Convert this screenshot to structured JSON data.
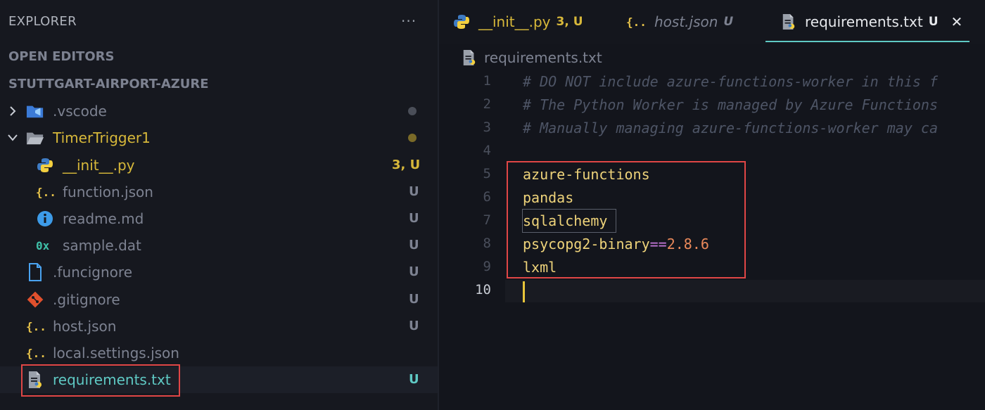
{
  "sidebar": {
    "title": "EXPLORER",
    "more": "···",
    "open_editors": "OPEN EDITORS",
    "project": "STUTTGART-AIRPORT-AZURE",
    "items": [
      {
        "name": ".vscode",
        "status": ""
      },
      {
        "name": "TimerTrigger1",
        "status": ""
      },
      {
        "name": "__init__.py",
        "status": "3, U"
      },
      {
        "name": "function.json",
        "status": "U"
      },
      {
        "name": "readme.md",
        "status": "U"
      },
      {
        "name": "sample.dat",
        "status": "U"
      },
      {
        "name": ".funcignore",
        "status": "U"
      },
      {
        "name": ".gitignore",
        "status": "U"
      },
      {
        "name": "host.json",
        "status": "U"
      },
      {
        "name": "local.settings.json",
        "status": ""
      },
      {
        "name": "requirements.txt",
        "status": "U"
      }
    ]
  },
  "tabs": [
    {
      "label": "__init__.py",
      "status": "3, U"
    },
    {
      "label": "host.json",
      "status": "U"
    },
    {
      "label": "requirements.txt",
      "status": "U",
      "close": "✕"
    }
  ],
  "breadcrumb": "requirements.txt",
  "editor": {
    "line_numbers": [
      "1",
      "2",
      "3",
      "4",
      "5",
      "6",
      "7",
      "8",
      "9",
      "10"
    ],
    "lines": [
      "# DO NOT include azure-functions-worker in this f",
      "# The Python Worker is managed by Azure Functions",
      "# Manually managing azure-functions-worker may ca",
      "",
      "azure-functions",
      "pandas",
      "sqlalchemy",
      "psycopg2-binary",
      "lxml",
      ""
    ],
    "op": "==",
    "version": "2.8.6"
  },
  "colors": {
    "accent": "#5fc9c4",
    "warning": "#d7b83a",
    "highlight_box": "#e04646"
  }
}
